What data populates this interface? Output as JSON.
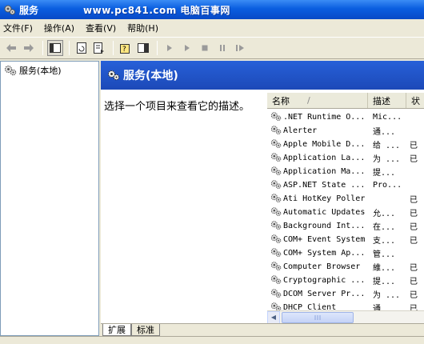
{
  "window": {
    "title": "服务",
    "watermark": "www.pc841.com 电脑百事网"
  },
  "menu": [
    "文件(F)",
    "操作(A)",
    "查看(V)",
    "帮助(H)"
  ],
  "tree": {
    "root_label": "服务(本地)"
  },
  "panel": {
    "header_title": "服务(本地)",
    "description_prompt": "选择一个项目来查看它的描述。"
  },
  "columns": {
    "name": "名称",
    "sort_indicator": "/",
    "desc": "描述",
    "status": "状"
  },
  "services": [
    {
      "name": ".NET Runtime O...",
      "desc": "Mic...",
      "status": ""
    },
    {
      "name": "Alerter",
      "desc": "通...",
      "status": ""
    },
    {
      "name": "Apple Mobile D...",
      "desc": "给 ...",
      "status": "已"
    },
    {
      "name": "Application La...",
      "desc": "为 ...",
      "status": "已"
    },
    {
      "name": "Application Ma...",
      "desc": "提...",
      "status": ""
    },
    {
      "name": "ASP.NET State ...",
      "desc": "Pro...",
      "status": ""
    },
    {
      "name": "Ati HotKey Poller",
      "desc": "",
      "status": "已"
    },
    {
      "name": "Automatic Updates",
      "desc": "允...",
      "status": "已"
    },
    {
      "name": "Background Int...",
      "desc": "在...",
      "status": "已"
    },
    {
      "name": "COM+ Event System",
      "desc": "支...",
      "status": "已"
    },
    {
      "name": "COM+ System Ap...",
      "desc": "管...",
      "status": ""
    },
    {
      "name": "Computer Browser",
      "desc": "維...",
      "status": "已"
    },
    {
      "name": "Cryptographic ...",
      "desc": "提...",
      "status": "已"
    },
    {
      "name": "DCOM Server Pr...",
      "desc": "为 ...",
      "status": "已"
    },
    {
      "name": "DHCP Client",
      "desc": "通",
      "status": "已"
    }
  ],
  "tabs": [
    "扩展",
    "标准"
  ],
  "colors": {
    "titlebar": "#0a5ee0",
    "panel_header": "#1f4fbf",
    "chrome": "#ece9d8"
  }
}
